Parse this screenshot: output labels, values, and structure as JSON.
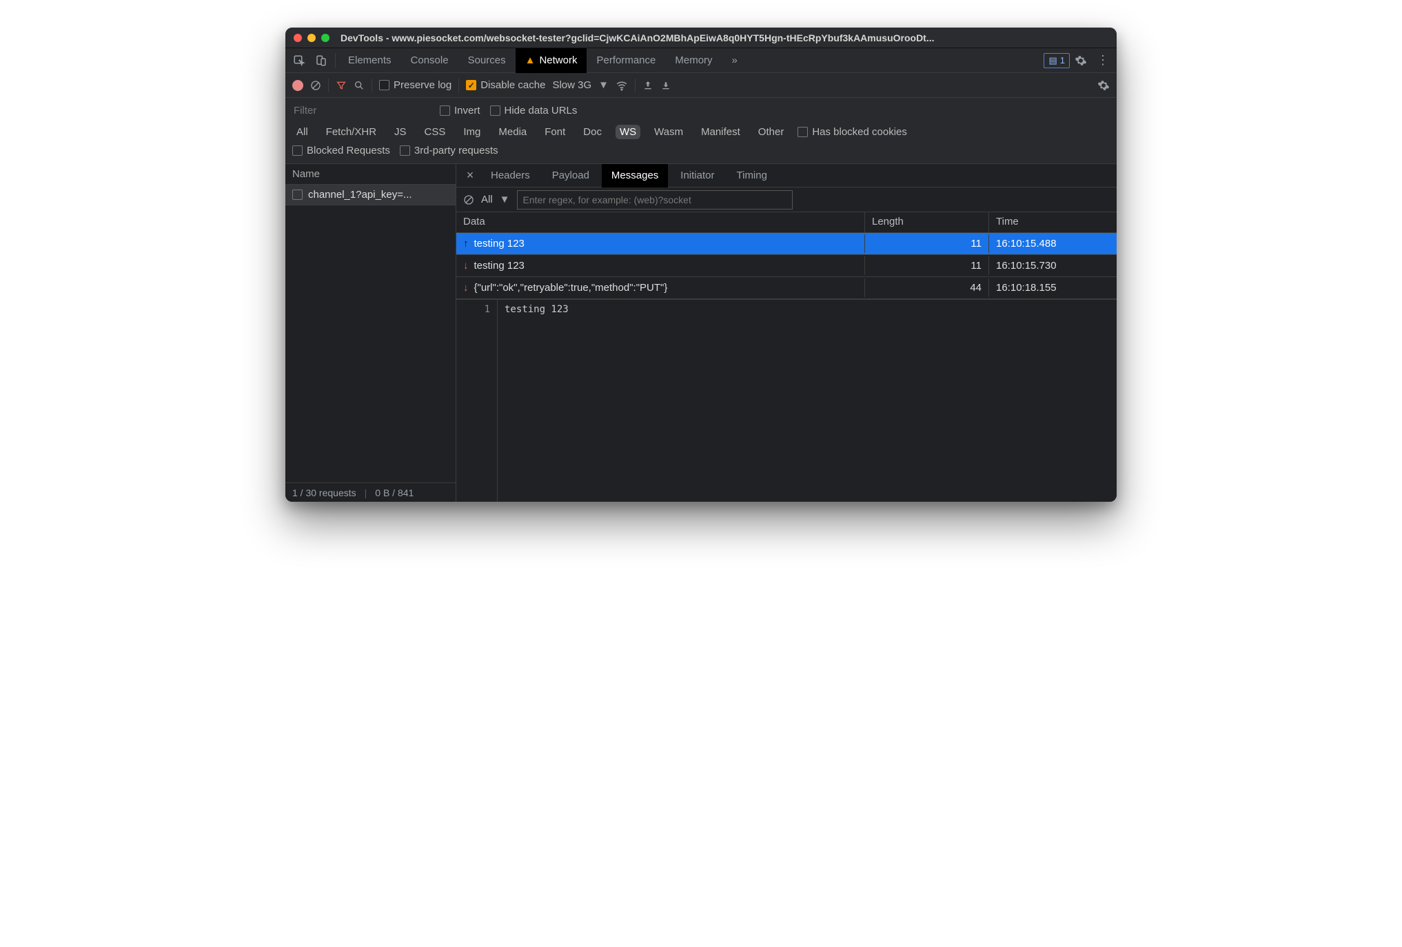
{
  "window": {
    "title": "DevTools - www.piesocket.com/websocket-tester?gclid=CjwKCAiAnO2MBhApEiwA8q0HYT5Hgn-tHEcRpYbuf3kAAmusuOrooDt..."
  },
  "tabs": {
    "items": [
      "Elements",
      "Console",
      "Sources",
      "Network",
      "Performance",
      "Memory"
    ],
    "active": "Network",
    "hasWarning": true,
    "more": "»",
    "issues_count": "1"
  },
  "toolbar": {
    "preserve_log": "Preserve log",
    "disable_cache": "Disable cache",
    "throttle": "Slow 3G"
  },
  "filter": {
    "placeholder": "Filter",
    "invert": "Invert",
    "hide_data_urls": "Hide data URLs",
    "types": [
      "All",
      "Fetch/XHR",
      "JS",
      "CSS",
      "Img",
      "Media",
      "Font",
      "Doc",
      "WS",
      "Wasm",
      "Manifest",
      "Other"
    ],
    "active_type": "WS",
    "has_blocked": "Has blocked cookies",
    "blocked_req": "Blocked Requests",
    "third_party": "3rd-party requests"
  },
  "sidebar": {
    "header": "Name",
    "requests": [
      {
        "name": "channel_1?api_key=..."
      }
    ],
    "status": {
      "requests": "1 / 30 requests",
      "transfer": "0 B / 841"
    }
  },
  "detail": {
    "tabs": [
      "Headers",
      "Payload",
      "Messages",
      "Initiator",
      "Timing"
    ],
    "active": "Messages"
  },
  "messages": {
    "filter_all": "All",
    "regex_placeholder": "Enter regex, for example: (web)?socket",
    "columns": {
      "data": "Data",
      "length": "Length",
      "time": "Time"
    },
    "rows": [
      {
        "direction": "up",
        "data": "testing 123",
        "length": "11",
        "time": "16:10:15.488",
        "selected": true
      },
      {
        "direction": "down",
        "data": "testing 123",
        "length": "11",
        "time": "16:10:15.730",
        "selected": false
      },
      {
        "direction": "down",
        "data": "{\"url\":\"ok\",\"retryable\":true,\"method\":\"PUT\"}",
        "length": "44",
        "time": "16:10:18.155",
        "selected": false
      }
    ],
    "preview": {
      "line": "1",
      "text": "testing 123"
    }
  }
}
